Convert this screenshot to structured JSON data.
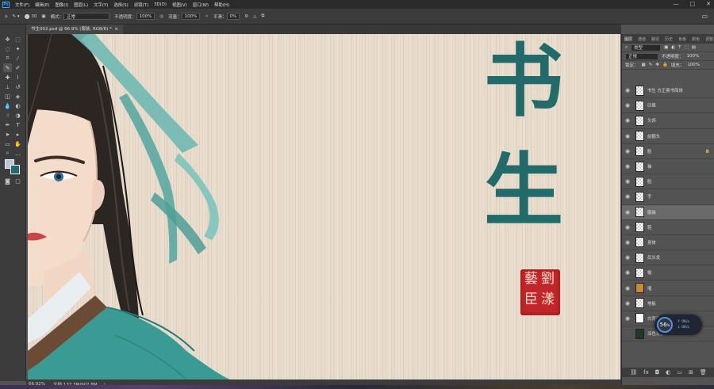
{
  "app": {
    "logo": "Ps",
    "win_controls": [
      "—",
      "□",
      "✕"
    ]
  },
  "menu": [
    "文件(F)",
    "编辑(E)",
    "图像(I)",
    "图层(L)",
    "文字(Y)",
    "选择(S)",
    "滤镜(T)",
    "3D(D)",
    "视图(V)",
    "窗口(W)",
    "帮助(H)"
  ],
  "options": {
    "brush_size": "30",
    "mode_label": "模式：",
    "mode_value": "正常",
    "opacity_label": "不透明度：",
    "opacity_value": "100%",
    "flow_label": "流量：",
    "flow_value": "100%",
    "smooth_label": "平滑：",
    "smooth_value": "0%"
  },
  "document": {
    "tab_title": "书生002.psd @ 66.9% (服装, RGB/8) *",
    "close": "×"
  },
  "canvas": {
    "title_char_1": "书",
    "title_char_2": "生",
    "seal_chars": [
      "劉",
      "漾",
      "藝",
      "臣"
    ]
  },
  "status": {
    "zoom": "66.92%",
    "doc_size": "文档:137.3M/907.8M"
  },
  "panel": {
    "tabs": [
      "图层",
      "通道",
      "路径",
      "历史",
      "色板",
      "颜色",
      "调整"
    ],
    "filter_label": "类型",
    "blend_mode": "正常",
    "opacity_label": "不透明度：",
    "opacity_value": "100%",
    "lock_label": "锁定：",
    "fill_label": "填充：",
    "fill_value": "100%"
  },
  "layers": [
    {
      "name": "书生 方正素书简体",
      "selected": false,
      "lock": false
    },
    {
      "name": "印章",
      "selected": false,
      "lock": false
    },
    {
      "name": "头饰",
      "selected": false,
      "lock": false
    },
    {
      "name": "前额头",
      "selected": false,
      "lock": false
    },
    {
      "name": "脸",
      "selected": false,
      "lock": true
    },
    {
      "name": "袖",
      "selected": false,
      "lock": false
    },
    {
      "name": "脸",
      "selected": false,
      "lock": false
    },
    {
      "name": "手",
      "selected": false,
      "lock": false
    },
    {
      "name": "服装",
      "selected": true,
      "lock": false
    },
    {
      "name": "鞋",
      "selected": false,
      "lock": false
    },
    {
      "name": "身体",
      "selected": false,
      "lock": false
    },
    {
      "name": "后头发",
      "selected": false,
      "lock": false
    },
    {
      "name": "帽",
      "selected": false,
      "lock": false
    },
    {
      "name": "墙",
      "selected": false,
      "lock": false
    },
    {
      "name": "地板",
      "selected": false,
      "lock": false
    },
    {
      "name": "白背景",
      "selected": false,
      "lock": false
    },
    {
      "name": "深色背景",
      "selected": false,
      "lock": false
    }
  ],
  "zoom_badge": {
    "value": "56",
    "unit": "%",
    "up": "0K/s",
    "down": "0K/s"
  },
  "colors": {
    "accent": "#236a6b",
    "seal": "#c2262a",
    "teal_robe": "#3a9a94",
    "ui_dark": "#3c3c3c"
  }
}
